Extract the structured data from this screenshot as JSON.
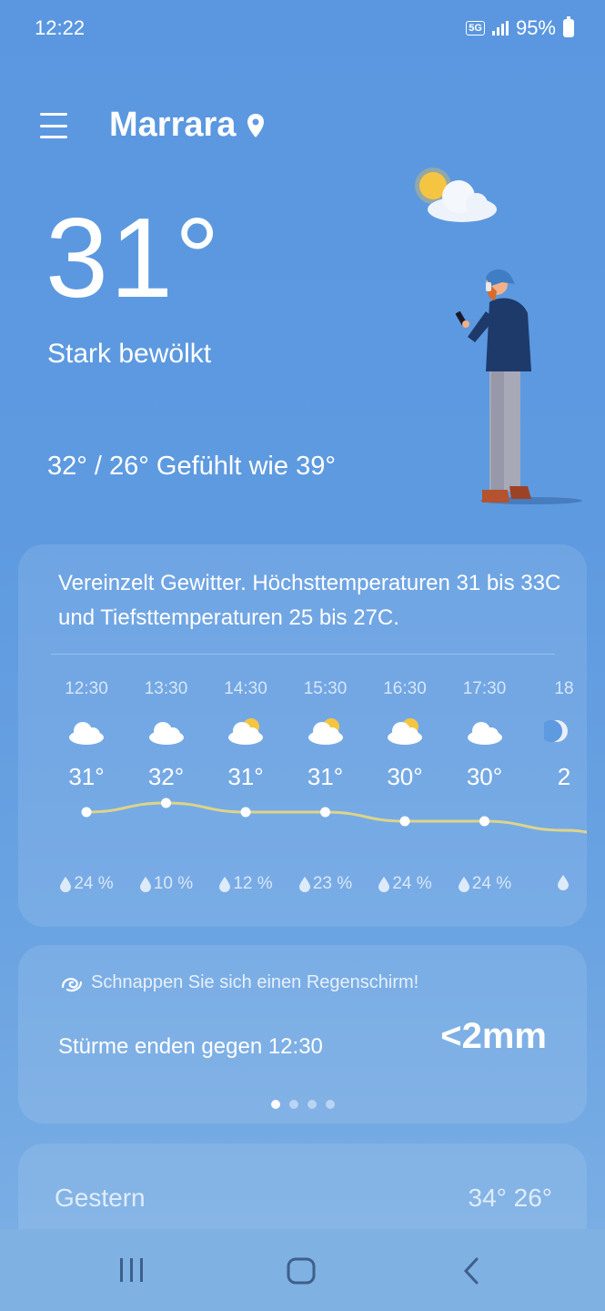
{
  "status": {
    "time": "12:22",
    "network": "5G",
    "battery": "95%"
  },
  "header": {
    "location": "Marrara"
  },
  "current": {
    "temperature": "31°",
    "condition": "Stark bewölkt",
    "high_low_feels": "32° / 26° Gefühlt wie 39°"
  },
  "forecast": {
    "summary": "Vereinzelt Gewitter. Höchsttemperaturen 31 bis 33C und Tiefsttemperaturen 25 bis 27C.",
    "hours": [
      {
        "time": "12:30",
        "icon": "cloud-icon",
        "temp": "31°",
        "rain": "24 %"
      },
      {
        "time": "13:30",
        "icon": "cloud-icon",
        "temp": "32°",
        "rain": "10 %"
      },
      {
        "time": "14:30",
        "icon": "partly-cloudy-icon",
        "temp": "31°",
        "rain": "12 %"
      },
      {
        "time": "15:30",
        "icon": "partly-cloudy-icon",
        "temp": "31°",
        "rain": "23 %"
      },
      {
        "time": "16:30",
        "icon": "partly-cloudy-icon",
        "temp": "30°",
        "rain": "24 %"
      },
      {
        "time": "17:30",
        "icon": "cloud-icon",
        "temp": "30°",
        "rain": "24 %"
      },
      {
        "time": "18",
        "icon": "moon-cloud-icon",
        "temp": "2",
        "rain": ""
      }
    ],
    "temp_values": [
      31,
      32,
      31,
      31,
      30,
      30,
      29
    ]
  },
  "rain_card": {
    "note": "Schnappen Sie sich einen Regenschirm!",
    "storm": "Stürme enden gegen 12:30",
    "amount": "<2mm",
    "pages": 4,
    "active_page": 0
  },
  "yesterday": {
    "label": "Gestern",
    "temps": "34° 26°"
  },
  "colors": {
    "background": "#5e9ae0",
    "sun": "#f5c542",
    "line": "#f0dc7a"
  }
}
